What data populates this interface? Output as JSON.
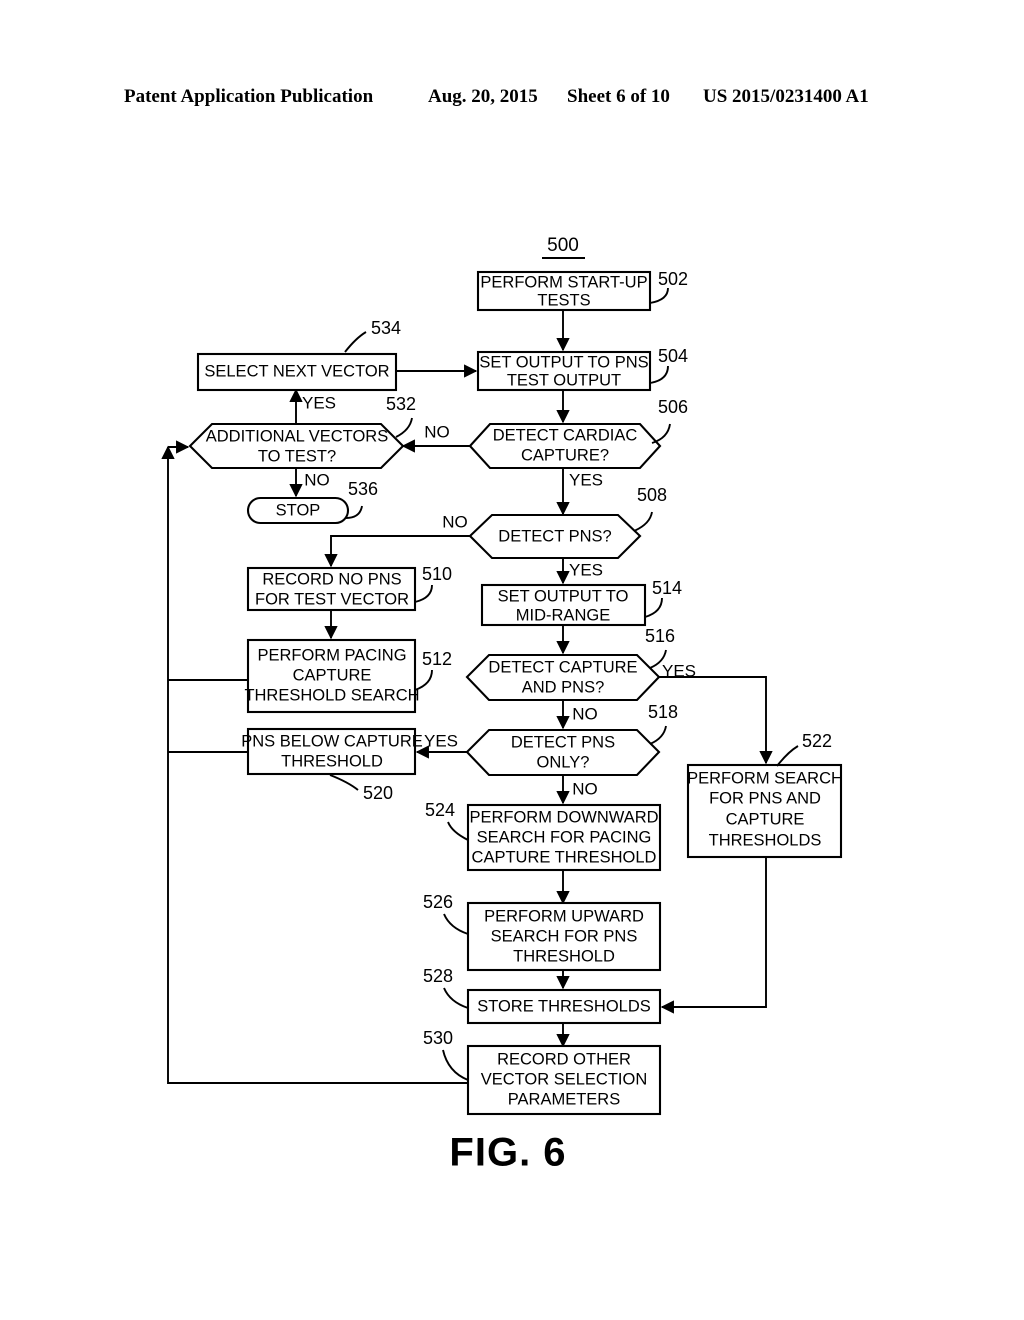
{
  "header": {
    "title": "Patent Application Publication",
    "date": "Aug. 20, 2015",
    "sheet": "Sheet 6 of 10",
    "patent_number": "US 2015/0231400 A1"
  },
  "figure": {
    "caption": "FIG. 6",
    "diagram_ref": "500",
    "nodes": [
      {
        "ref": "502",
        "shape": "process",
        "lines": [
          "PERFORM START-UP",
          "TESTS"
        ]
      },
      {
        "ref": "504",
        "shape": "process",
        "lines": [
          "SET OUTPUT TO PNS",
          "TEST OUTPUT"
        ]
      },
      {
        "ref": "506",
        "shape": "decision",
        "lines": [
          "DETECT CARDIAC",
          "CAPTURE?"
        ]
      },
      {
        "ref": "508",
        "shape": "decision",
        "lines": [
          "DETECT PNS?"
        ]
      },
      {
        "ref": "510",
        "shape": "process",
        "lines": [
          "RECORD NO PNS",
          "FOR TEST VECTOR"
        ]
      },
      {
        "ref": "512",
        "shape": "process",
        "lines": [
          "PERFORM PACING",
          "CAPTURE",
          "THRESHOLD SEARCH"
        ]
      },
      {
        "ref": "514",
        "shape": "process",
        "lines": [
          "SET OUTPUT TO",
          "MID-RANGE"
        ]
      },
      {
        "ref": "516",
        "shape": "decision",
        "lines": [
          "DETECT CAPTURE",
          "AND PNS?"
        ]
      },
      {
        "ref": "518",
        "shape": "decision",
        "lines": [
          "DETECT PNS",
          "ONLY?"
        ]
      },
      {
        "ref": "520",
        "shape": "process",
        "lines": [
          "PNS BELOW CAPTURE",
          "THRESHOLD"
        ]
      },
      {
        "ref": "522",
        "shape": "process",
        "lines": [
          "PERFORM SEARCH",
          "FOR PNS AND",
          "CAPTURE",
          "THRESHOLDS"
        ]
      },
      {
        "ref": "524",
        "shape": "process",
        "lines": [
          "PERFORM DOWNWARD",
          "SEARCH FOR PACING",
          "CAPTURE THRESHOLD"
        ]
      },
      {
        "ref": "526",
        "shape": "process",
        "lines": [
          "PERFORM UPWARD",
          "SEARCH FOR PNS",
          "THRESHOLD"
        ]
      },
      {
        "ref": "528",
        "shape": "process",
        "lines": [
          "STORE THRESHOLDS"
        ]
      },
      {
        "ref": "530",
        "shape": "process",
        "lines": [
          "RECORD OTHER",
          "VECTOR SELECTION",
          "PARAMETERS"
        ]
      },
      {
        "ref": "532",
        "shape": "decision",
        "lines": [
          "ADDITIONAL VECTORS",
          "TO TEST?"
        ]
      },
      {
        "ref": "534",
        "shape": "process",
        "lines": [
          "SELECT NEXT VECTOR"
        ]
      },
      {
        "ref": "536",
        "shape": "terminator",
        "lines": [
          "STOP"
        ]
      }
    ],
    "edge_labels": {
      "cardiac_capture_no": "NO",
      "cardiac_capture_yes": "YES",
      "detect_pns_no": "NO",
      "detect_pns_yes": "YES",
      "capture_and_pns_yes": "YES",
      "capture_and_pns_no": "NO",
      "pns_only_yes": "YES",
      "pns_only_no": "NO",
      "additional_vectors_yes": "YES",
      "additional_vectors_no": "NO"
    },
    "colors": {
      "ink": "#000000",
      "paper": "#ffffff"
    }
  }
}
